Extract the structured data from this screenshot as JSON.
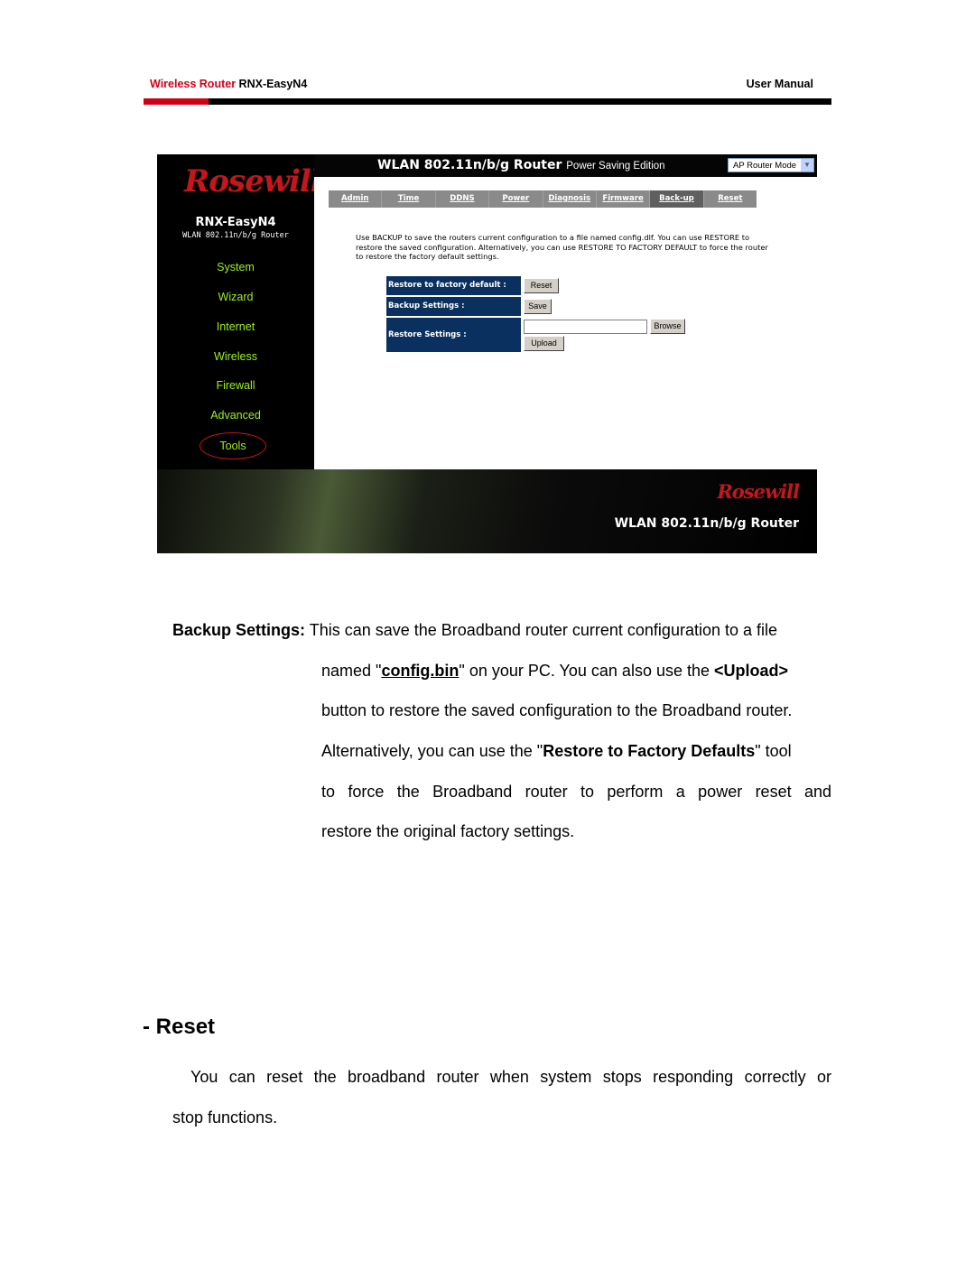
{
  "header": {
    "product_label": "Wireless Router",
    "model": "RNX-EasyN4",
    "doc_type": "User Manual",
    "accent_color": "#d0021b"
  },
  "screenshot": {
    "brand_logo": "Rosewill",
    "title_main": "WLAN 802.11n/b/g Router",
    "title_sub": "Power Saving Edition",
    "mode_select": "AP Router Mode",
    "model_name": "RNX-EasyN4",
    "model_sub": "WLAN 802.11n/b/g Router",
    "nav": [
      "System",
      "Wizard",
      "Internet",
      "Wireless",
      "Firewall",
      "Advanced",
      "Tools"
    ],
    "nav_color": "#9ef01a",
    "tabs": [
      "Admin",
      "Time",
      "DDNS",
      "Power",
      "Diagnosis",
      "Firmware",
      "Back-up",
      "Reset"
    ],
    "active_tab": "Back-up",
    "description": "Use BACKUP to save the routers current configuration to a file named config.dlf. You can use RESTORE to restore the saved configuration. Alternatively, you can use RESTORE TO FACTORY DEFAULT to force the router to restore the factory default settings.",
    "form": {
      "restore_factory_label": "Restore to factory default :",
      "reset_button": "Reset",
      "backup_label": "Backup Settings :",
      "save_button": "Save",
      "restore_label": "Restore Settings :",
      "file_value": "",
      "browse_button": "Browse",
      "upload_button": "Upload"
    },
    "banner_logo": "Rosewill",
    "banner_title": "WLAN 802.11n/b/g Router"
  },
  "body": {
    "backup_term": "Backup Settings:",
    "line1": "This can save the Broadband router current configuration to a file",
    "line2_a": "named \"",
    "line2_file": "config.bin",
    "line2_b": "\" on your PC. You can also use the ",
    "line2_upload": "<Upload>",
    "line3": "button to restore the saved configuration to the Broadband router.",
    "line4_a": "Alternatively, you can use the \"",
    "line4_bold": "Restore to Factory Defaults",
    "line4_b": "\" tool",
    "line5": "to force the Broadband router to perform a power reset and",
    "line6": "restore the original factory settings.",
    "reset_heading": "- Reset",
    "reset_line1": "You can reset the broadband router when system stops responding correctly or",
    "reset_line2": "stop functions."
  }
}
